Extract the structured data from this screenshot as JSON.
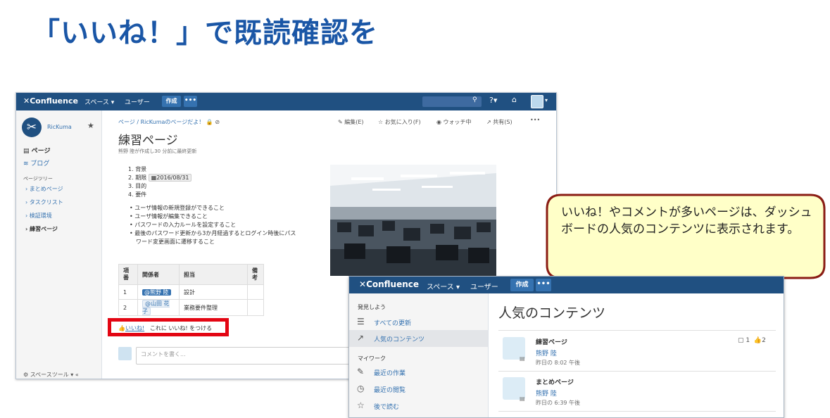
{
  "slide": {
    "title": "「いいね！」で既読確認を"
  },
  "confluence": {
    "nav": {
      "logo": "Confluence",
      "spaces": "スペース",
      "people": "ユーザー",
      "create": "作成",
      "more": "•••"
    },
    "sidebar": {
      "space_name": "RicKuma",
      "pages": "ページ",
      "blog": "ブログ",
      "tree_header": "ページツリー",
      "tree": [
        "まとめページ",
        "タスクリスト",
        "検証環境",
        "練習ページ"
      ],
      "tools": "スペースツール"
    },
    "breadcrumb": "ページ / RicKumaのページだよ！",
    "actions": {
      "edit": "編集(E)",
      "favorite": "お気に入り(F)",
      "watching": "ウォッチ中",
      "share": "共有(S)",
      "more": "•••"
    },
    "page": {
      "title": "練習ページ",
      "byline": "熊野 陸が作成し30 分前に最終更新",
      "numbered": [
        "背景",
        "期限",
        "目的",
        "要件"
      ],
      "deadline_date": "2016/08/31",
      "bullets": [
        "ユーザ情報の新規登録ができること",
        "ユーザ情報が編集できること",
        "パスワードの入力ルールを設定すること",
        "最後のパスワード更新から3か月経過するとログイン時後にパス",
        "ワード変更画面に遷移すること"
      ],
      "table": {
        "headers": [
          "項番",
          "関係者",
          "担当",
          "備考"
        ],
        "rows": [
          {
            "no": "1",
            "person": "@熊野 陸",
            "role": "設計",
            "note": ""
          },
          {
            "no": "2",
            "person": "@山田 花子",
            "role": "業務要件整理",
            "note": ""
          }
        ]
      },
      "like_label": "いいね!",
      "like_prompt": "これに いいね! をつける",
      "comment_placeholder": "コメントを書く..."
    }
  },
  "callout": {
    "text": "いいね！やコメントが多いページは、ダッシュボードの人気のコンテンツに表示されます。"
  },
  "dashboard": {
    "nav": {
      "logo": "Confluence",
      "spaces": "スペース",
      "people": "ユーザー",
      "create": "作成",
      "more": "•••"
    },
    "sidebar": {
      "discover_header": "発見しよう",
      "discover": [
        "すべての更新",
        "人気のコンテンツ"
      ],
      "work_header": "マイワーク",
      "work": [
        "最近の作業",
        "最近の閲覧",
        "後で読む"
      ]
    },
    "title": "人気のコンテンツ",
    "items": [
      {
        "title": "練習ページ",
        "author": "熊野 陸",
        "time": "昨日の 8:02 午後",
        "comments": "1",
        "likes": "2"
      },
      {
        "title": "まとめページ",
        "author": "熊野 陸",
        "time": "昨日の 6:39 午後"
      }
    ]
  }
}
